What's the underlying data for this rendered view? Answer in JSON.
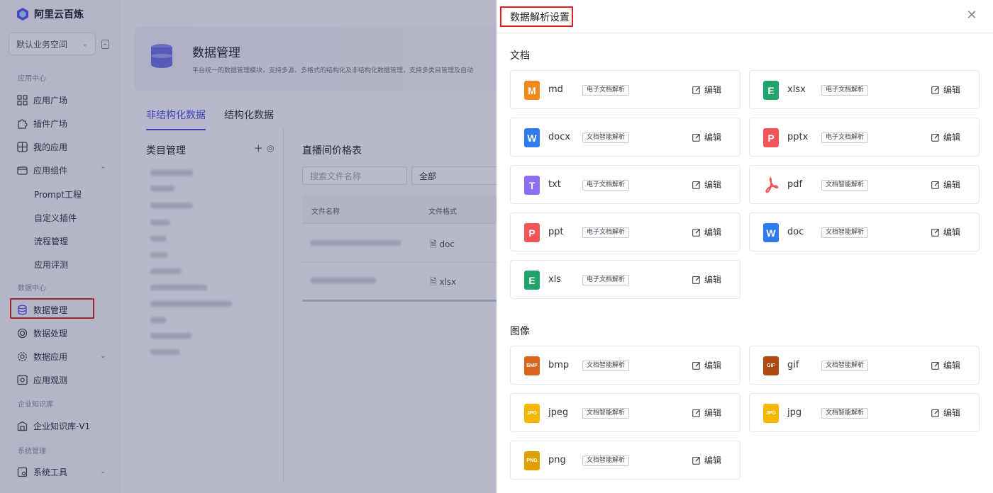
{
  "sidebar": {
    "brand": "阿里云百炼",
    "workspace": "默认业务空间",
    "sections": {
      "app_center": "应用中心",
      "data_center": "数据中心",
      "knowledge": "企业知识库",
      "system": "系统管理"
    },
    "items": {
      "app_plaza": "应用广场",
      "plugin_plaza": "插件广场",
      "my_apps": "我的应用",
      "app_components": "应用组件",
      "prompt": "Prompt工程",
      "custom_plugin": "自定义插件",
      "flow": "流程管理",
      "eval": "应用评测",
      "data_mgmt": "数据管理",
      "data_proc": "数据处理",
      "data_app": "数据应用",
      "app_observe": "应用观测",
      "kb": "企业知识库-V1",
      "sys_tools": "系统工具"
    }
  },
  "main": {
    "title": "数据管理",
    "desc": "平台统一的数据管理模块，支持多源、多格式的结构化及非结构化数据管理，支持多类目管理及自动",
    "tabs": [
      "非结构化数据",
      "结构化数据"
    ],
    "category_title": "类目管理",
    "table_title": "直播间价格表",
    "search_placeholder": "搜索文件名称",
    "filter_value": "全部",
    "columns": [
      "文件名称",
      "文件格式"
    ],
    "rows": [
      {
        "format": "doc"
      },
      {
        "format": "xlsx"
      }
    ]
  },
  "drawer": {
    "title": "数据解析设置",
    "edit_label": "编辑",
    "groups": [
      {
        "title": "文档",
        "items": [
          {
            "name": "md",
            "parser": "电子文档解析",
            "icon": "M",
            "color": "#f08a1d"
          },
          {
            "name": "xlsx",
            "parser": "电子文档解析",
            "icon": "E",
            "color": "#1fa56b"
          },
          {
            "name": "docx",
            "parser": "文档智能解析",
            "icon": "W",
            "color": "#2f7bf0"
          },
          {
            "name": "pptx",
            "parser": "电子文档解析",
            "icon": "P",
            "color": "#f0555a"
          },
          {
            "name": "txt",
            "parser": "电子文档解析",
            "icon": "T",
            "color": "#8b6ff0"
          },
          {
            "name": "pdf",
            "parser": "文档智能解析",
            "icon": "pdf",
            "color": "#f0555a"
          },
          {
            "name": "ppt",
            "parser": "电子文档解析",
            "icon": "P",
            "color": "#f0555a"
          },
          {
            "name": "doc",
            "parser": "文档智能解析",
            "icon": "W",
            "color": "#2f7bf0"
          },
          {
            "name": "xls",
            "parser": "电子文档解析",
            "icon": "E",
            "color": "#1fa56b"
          }
        ]
      },
      {
        "title": "图像",
        "items": [
          {
            "name": "bmp",
            "parser": "文档智能解析",
            "icon": "BMP",
            "color": "#d9641b"
          },
          {
            "name": "gif",
            "parser": "文档智能解析",
            "icon": "GIF",
            "color": "#b04a10"
          },
          {
            "name": "jpeg",
            "parser": "文档智能解析",
            "icon": "JPG",
            "color": "#f5b800"
          },
          {
            "name": "jpg",
            "parser": "文档智能解析",
            "icon": "JPG",
            "color": "#f5b800"
          },
          {
            "name": "png",
            "parser": "文档智能解析",
            "icon": "PNG",
            "color": "#e0a000"
          }
        ]
      }
    ]
  }
}
